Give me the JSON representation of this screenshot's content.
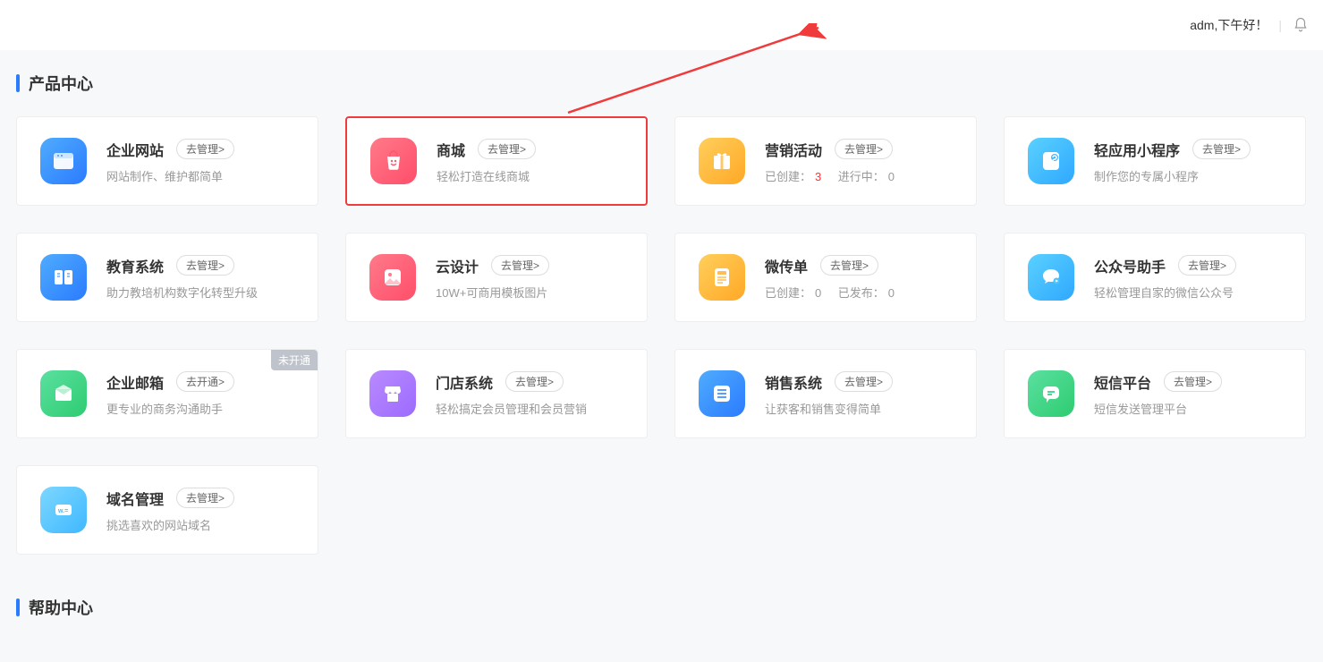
{
  "header": {
    "greeting": "adm,下午好！"
  },
  "sections": {
    "products_title": "产品中心",
    "help_title": "帮助中心"
  },
  "cards": [
    {
      "title": "企业网站",
      "button": "去管理>",
      "subtitle": "网站制作、维护都简单"
    },
    {
      "title": "商城",
      "button": "去管理>",
      "subtitle": "轻松打造在线商城"
    },
    {
      "title": "营销活动",
      "button": "去管理>",
      "sub_prefix1": "已创建：",
      "sub_val1": "3",
      "sub_prefix2": "进行中：",
      "sub_val2": "0"
    },
    {
      "title": "轻应用小程序",
      "button": "去管理>",
      "subtitle": "制作您的专属小程序"
    },
    {
      "title": "教育系统",
      "button": "去管理>",
      "subtitle": "助力教培机构数字化转型升级"
    },
    {
      "title": "云设计",
      "button": "去管理>",
      "subtitle": "10W+可商用模板图片"
    },
    {
      "title": "微传单",
      "button": "去管理>",
      "sub_prefix1": "已创建：",
      "sub_val1": "0",
      "sub_prefix2": "已发布：",
      "sub_val2": "0"
    },
    {
      "title": "公众号助手",
      "button": "去管理>",
      "subtitle": "轻松管理自家的微信公众号"
    },
    {
      "title": "企业邮箱",
      "button": "去开通>",
      "subtitle": "更专业的商务沟通助手",
      "tag": "未开通"
    },
    {
      "title": "门店系统",
      "button": "去管理>",
      "subtitle": "轻松搞定会员管理和会员营销"
    },
    {
      "title": "销售系统",
      "button": "去管理>",
      "subtitle": "让获客和销售变得简单"
    },
    {
      "title": "短信平台",
      "button": "去管理>",
      "subtitle": "短信发送管理平台"
    },
    {
      "title": "域名管理",
      "button": "去管理>",
      "subtitle": "挑选喜欢的网站域名"
    }
  ]
}
